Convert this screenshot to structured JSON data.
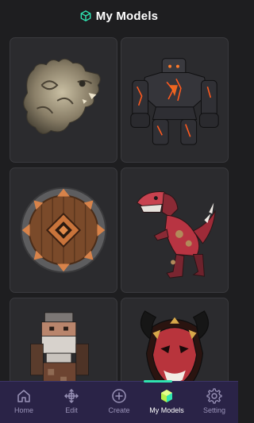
{
  "header": {
    "title": "My Models",
    "icon": "cube-icon"
  },
  "models": [
    {
      "name": "serpent-dragon-head-relief"
    },
    {
      "name": "lava-rock-golem"
    },
    {
      "name": "wooden-rune-shield"
    },
    {
      "name": "red-mech-dinosaur"
    },
    {
      "name": "voxel-bearded-warrior"
    },
    {
      "name": "red-horned-oni-mask"
    }
  ],
  "tabbar": {
    "active": "My Models",
    "accent": "#2fe3b0",
    "tabs": [
      {
        "label": "Home",
        "icon": "home-icon"
      },
      {
        "label": "Edit",
        "icon": "move-arrows-icon"
      },
      {
        "label": "Create",
        "icon": "plus-circle-icon"
      },
      {
        "label": "My Models",
        "icon": "cube-icon"
      },
      {
        "label": "Setting",
        "icon": "gear-icon"
      }
    ]
  }
}
